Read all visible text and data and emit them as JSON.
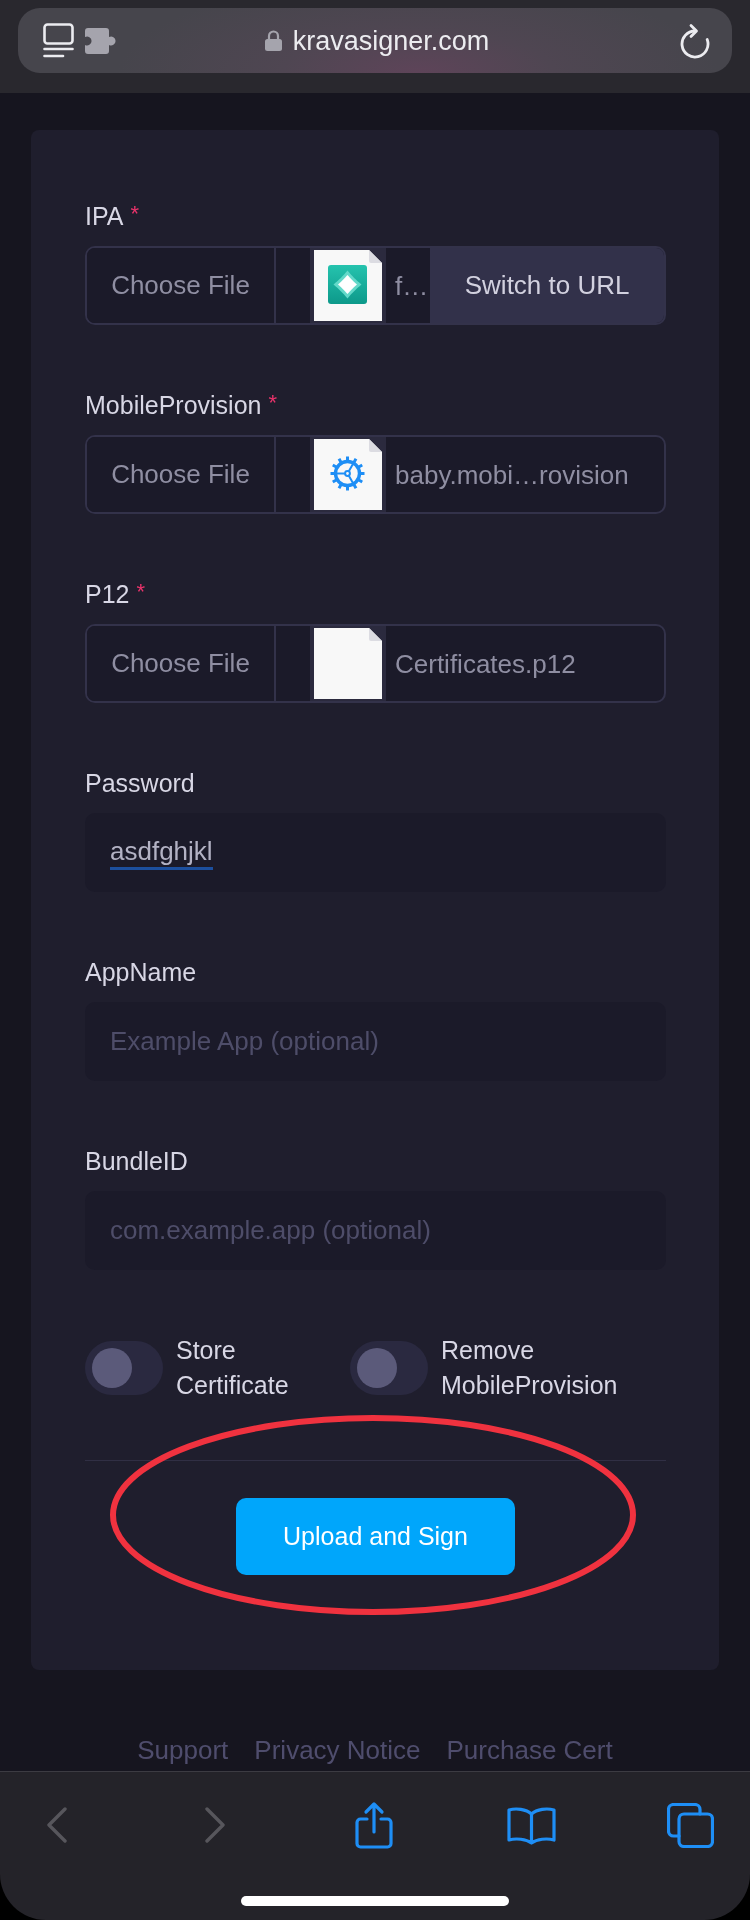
{
  "browser": {
    "url": "kravasigner.com",
    "secure": true
  },
  "fields": [
    {
      "kind": "file",
      "label": "IPA",
      "required_mark": "*",
      "button": "Choose File",
      "file": {
        "kind": "ipa",
        "name": "f…"
      },
      "switch_button": "Switch to URL"
    },
    {
      "kind": "file",
      "label": "MobileProvision",
      "required_mark": "*",
      "button": "Choose File",
      "file": {
        "kind": "mobileprovision",
        "name": "baby.mobi…rovision"
      }
    },
    {
      "kind": "file",
      "label": "P12",
      "required_mark": "*",
      "button": "Choose File",
      "file": {
        "kind": "p12",
        "name": "Certificates.p12"
      }
    },
    {
      "kind": "text",
      "label": "Password",
      "value": "asdfghjkl",
      "spelling_flagged": true
    },
    {
      "kind": "text",
      "label": "AppName",
      "placeholder": "Example App (optional)"
    },
    {
      "kind": "text",
      "label": "BundleID",
      "placeholder": "com.example.app (optional)"
    }
  ],
  "toggles": [
    {
      "label": "Store Certificate",
      "on": false
    },
    {
      "label": "Remove MobileProvision",
      "on": false
    }
  ],
  "submit": {
    "label": "Upload and Sign",
    "highlighted": true
  },
  "footer_links": [
    "Support",
    "Privacy Notice",
    "Purchase Cert"
  ],
  "toolbar": {
    "back": {
      "disabled": true
    },
    "forward": {
      "disabled": true
    }
  }
}
